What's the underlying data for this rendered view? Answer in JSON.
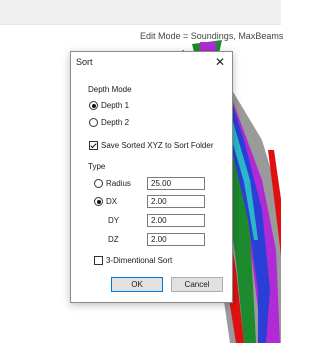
{
  "header": {
    "mode_text": "Edit Mode = Soundings, MaxBeams"
  },
  "dialog": {
    "title": "Sort",
    "depth_mode": {
      "group_label": "Depth Mode",
      "options": [
        "Depth 1",
        "Depth 2"
      ],
      "selected": "Depth 1"
    },
    "save_sorted": {
      "label": "Save Sorted XYZ to Sort Folder",
      "checked": true
    },
    "type": {
      "group_label": "Type",
      "radius_label": "Radius",
      "radius_value": "25.00",
      "dx_label": "DX",
      "dx_value": "2.00",
      "dy_label": "DY",
      "dy_value": "2.00",
      "dz_label": "DZ",
      "dz_value": "2.00",
      "selected": "DX"
    },
    "three_d_sort": {
      "label": "3-Dimentional Sort",
      "checked": false
    },
    "buttons": {
      "ok": "OK",
      "cancel": "Cancel"
    }
  },
  "scene_colors": {
    "bg": "#ffffff",
    "grey": "#9a9a9a",
    "green": "#1e8a2e",
    "magenta": "#b02ad6",
    "blue": "#2a3fd6",
    "red": "#e01010",
    "cyan": "#2ab8c8"
  }
}
